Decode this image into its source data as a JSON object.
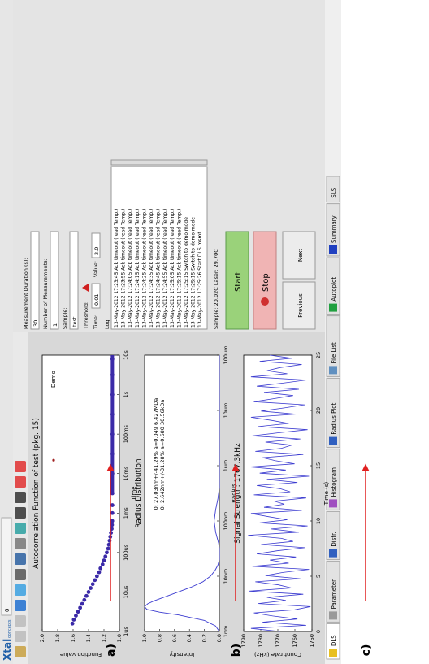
{
  "window": {
    "logo_line1": "Xtal",
    "logo_line2": "concepts",
    "tab_label": "0"
  },
  "toolbar": {
    "icons": [
      "edit-icon",
      "circle-icon",
      "circle-icon",
      "move-icon",
      "brush-icon",
      "monitor-icon",
      "save-icon",
      "print-icon",
      "grid-icon",
      "arrows-out-icon",
      "arrows-in-icon",
      "lifebuoy-icon",
      "power-icon"
    ]
  },
  "bottom_tabs": [
    {
      "label": "DLS",
      "icon": "warning-icon"
    },
    {
      "label": "Parameter",
      "icon": "wrench-icon"
    },
    {
      "label": "Distr.",
      "icon": "bars-icon"
    },
    {
      "label": "Histogram",
      "icon": "histogram-icon"
    },
    {
      "label": "Radius Plot",
      "icon": "waves-icon"
    },
    {
      "label": "File List",
      "icon": "file-icon"
    },
    {
      "label": "Autoplot",
      "icon": "globe-icon"
    },
    {
      "label": "Summary",
      "icon": "sigma-icon"
    },
    {
      "label": "SLS",
      "icon": ""
    }
  ],
  "charts": {
    "a": {
      "title": "Autocorrelation Function of test (pkg. 15)",
      "xlabel": "Time",
      "ylabel": "Function value",
      "annotation": "Demo",
      "xticks": [
        "1us",
        "10us",
        "100us",
        "1ms",
        "10ms",
        "100ms",
        "1s",
        "10s"
      ],
      "yticks": [
        "1.0",
        "1.2",
        "1.4",
        "1.6",
        "1.8",
        "2.0"
      ]
    },
    "b": {
      "title": "Radius Distribution",
      "xlabel": "Radius",
      "ylabel": "Intensity",
      "annotation_line1": "0: 27.03nm+/-41.29% a=0.049 6.427MDa",
      "annotation_line2": "0: 2.642nm+/-31.28% a=0.680 30.56kDa",
      "xticks": [
        "1nm",
        "10nm",
        "100nm",
        "1um",
        "10um",
        "100um"
      ],
      "yticks": [
        "0.0",
        "0.2",
        "0.4",
        "0.6",
        "0.8",
        "1.0"
      ]
    },
    "c": {
      "title": "Signal Strength: 1767.3kHz",
      "xlabel": "Time (s)",
      "ylabel": "Count rate (kHz)",
      "xticks": [
        "0",
        "5",
        "10",
        "15",
        "20",
        "25"
      ],
      "yticks": [
        "1750",
        "1760",
        "1770",
        "1780",
        "1790"
      ]
    }
  },
  "chart_data": [
    {
      "type": "scatter",
      "title": "Autocorrelation Function of test (pkg. 15)",
      "xlabel": "Time",
      "ylabel": "Function value",
      "x_scale": "log",
      "xlim_decades": [
        0,
        7
      ],
      "ylim": [
        0.9,
        2.0
      ],
      "x_decades": [
        0.2,
        0.3,
        0.4,
        0.5,
        0.6,
        0.7,
        0.8,
        0.9,
        1.0,
        1.1,
        1.2,
        1.3,
        1.4,
        1.5,
        1.6,
        1.7,
        1.8,
        1.9,
        2.0,
        2.1,
        2.2,
        2.3,
        2.4,
        2.5,
        2.6,
        2.7,
        2.8,
        3.0,
        3.2,
        3.5,
        4.0,
        4.5,
        5.0,
        5.5,
        6.0,
        6.5,
        6.9
      ],
      "y": [
        1.57,
        1.55,
        1.52,
        1.49,
        1.46,
        1.43,
        1.4,
        1.37,
        1.34,
        1.31,
        1.28,
        1.25,
        1.22,
        1.19,
        1.17,
        1.14,
        1.12,
        1.1,
        1.08,
        1.06,
        1.05,
        1.04,
        1.03,
        1.02,
        1.01,
        1.005,
        1.002,
        1.0,
        1.0,
        1.0,
        1.0,
        1.0,
        1.0,
        1.0,
        1.0,
        1.0,
        1.0
      ]
    },
    {
      "type": "line",
      "title": "Radius Distribution",
      "xlabel": "Radius",
      "ylabel": "Intensity",
      "x_scale": "log",
      "xlim_decades": [
        0,
        5
      ],
      "ylim": [
        0,
        1.0
      ],
      "x_decades": [
        0.0,
        0.1,
        0.2,
        0.3,
        0.35,
        0.4,
        0.45,
        0.5,
        0.55,
        0.6,
        0.7,
        0.8,
        0.9,
        1.0,
        1.1,
        1.2,
        1.3,
        1.4,
        1.5,
        1.6,
        1.7,
        1.8,
        2.0,
        2.2,
        2.4,
        2.5,
        2.6,
        3.0,
        4.0,
        5.0
      ],
      "y": [
        0.0,
        0.05,
        0.2,
        0.55,
        0.8,
        0.97,
        1.0,
        0.96,
        0.88,
        0.78,
        0.58,
        0.38,
        0.22,
        0.12,
        0.06,
        0.02,
        0.0,
        0.0,
        0.0,
        0.01,
        0.03,
        0.05,
        0.07,
        0.05,
        0.02,
        0.01,
        0.0,
        0.0,
        0.0,
        0.0
      ]
    },
    {
      "type": "line",
      "title": "Signal Strength: 1767.3kHz",
      "xlabel": "Time (s)",
      "ylabel": "Count rate (kHz)",
      "xlim": [
        0,
        29
      ],
      "ylim": [
        1748,
        1795
      ],
      "y": [
        1770,
        1790,
        1752,
        1782,
        1758,
        1775,
        1788,
        1760,
        1749,
        1785,
        1766,
        1779,
        1754,
        1791,
        1762,
        1771,
        1787,
        1756,
        1780,
        1768,
        1750,
        1789,
        1764,
        1777,
        1759,
        1786,
        1772,
        1753,
        1783,
        1761,
        1769,
        1792,
        1757,
        1776,
        1751,
        1784,
        1765,
        1778,
        1790,
        1755,
        1781,
        1767,
        1774,
        1752,
        1788,
        1763,
        1770,
        1786,
        1758,
        1779,
        1750,
        1784,
        1766,
        1791,
        1760,
        1773,
        1782,
        1754,
        1787,
        1769,
        1762,
        1780,
        1756,
        1789,
        1771,
        1751,
        1785,
        1764,
        1776,
        1790,
        1759,
        1783,
        1767,
        1753,
        1788,
        1774,
        1761,
        1781,
        1757,
        1786,
        1768,
        1752,
        1790,
        1765,
        1779,
        1770,
        1755,
        1784,
        1762,
        1777
      ]
    }
  ],
  "right_panel": {
    "fields": [
      {
        "label": "Measurement Duration (s):",
        "value": "30"
      },
      {
        "label": "Number of Measurements:",
        "value": "1"
      },
      {
        "label": "Sample:",
        "value": "test"
      }
    ],
    "threshold_label": "Threshold:",
    "time_label": "Time:",
    "time_value": "0.01",
    "value_label": "Value:",
    "value_value": "2.0",
    "log_label": "Log:",
    "log_lines": [
      "13-May-2012 17:23:45 Ack timeout (read Temp.)",
      "13-May-2012 17:23:55 Ack timeout (read Temp.)",
      "13-May-2012 17:24:05 Ack timeout (read Temp.)",
      "13-May-2012 17:24:15 Ack timeout (read Temp.)",
      "13-May-2012 17:24:25 Ack timeout (read Temp.)",
      "13-May-2012 17:24:35 Ack timeout (read Temp.)",
      "13-May-2012 17:24:45 Ack timeout (read Temp.)",
      "13-May-2012 17:24:55 Ack timeout (read Temp.)",
      "13-May-2012 17:25:05 Ack timeout (read Temp.)",
      "13-May-2012 17:25:15 Ack timeout (read Temp.)",
      "13-May-2012 17:25:15 Switch to demo mode",
      "13-May-2012 17:25:15 Switch to demo mode",
      "13-May-2012 17:25:26 Start DLS msmt."
    ],
    "status": "Sample: 20.02C  Laser: 29.70C",
    "start_label": "Start",
    "stop_label": "Stop",
    "previous_label": "Previous",
    "next_label": "Next",
    "start_color": "#9ad27a",
    "stop_color": "#f0b4b4"
  },
  "annotations": [
    "a)",
    "b)",
    "c)"
  ],
  "colors": {
    "plot_line": "#3b3bd0",
    "scatter": "#3b2aa8",
    "arrow": "#e02020",
    "panel_bg": "#d8d8d8"
  }
}
